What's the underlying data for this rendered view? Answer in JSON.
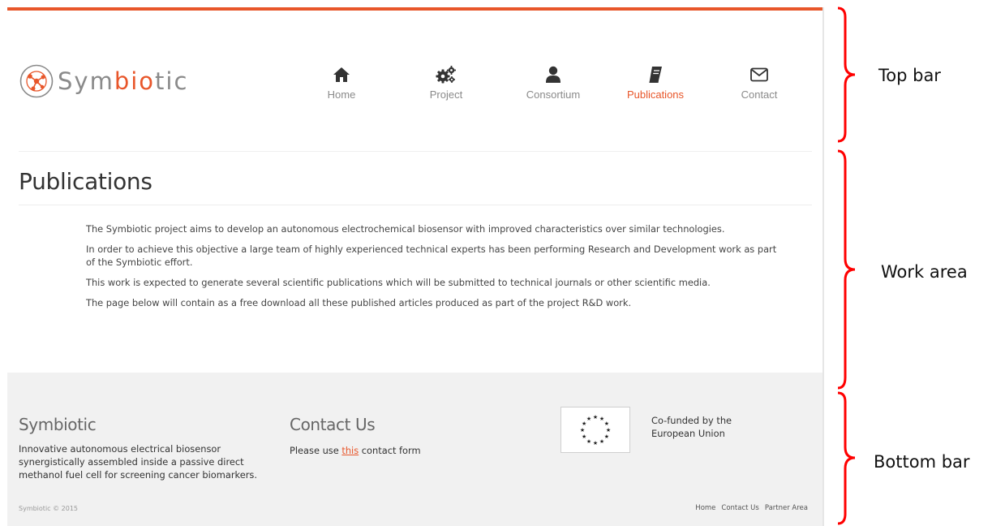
{
  "header": {
    "logo_prefix": "Sym",
    "logo_bio": "bio",
    "logo_suffix": "tic",
    "nav": [
      {
        "label": "Home",
        "icon": "home-icon",
        "active": false
      },
      {
        "label": "Project",
        "icon": "cogs-icon",
        "active": false
      },
      {
        "label": "Consortium",
        "icon": "user-icon",
        "active": false
      },
      {
        "label": "Publications",
        "icon": "book-icon",
        "active": true
      },
      {
        "label": "Contact",
        "icon": "envelope-icon",
        "active": false
      }
    ]
  },
  "main": {
    "title": "Publications",
    "paragraphs": [
      "The Symbiotic project aims to develop an autonomous electrochemical biosensor with improved characteristics over similar technologies.",
      "In order to achieve this objective a large team of highly experienced technical experts has been performing Research and Development work as part of the Symbiotic effort.",
      "This work is expected to generate several scientific publications which will be submitted to technical journals or other scientific media.",
      "The page below will contain as a free download all these published articles produced as part of the project R&D work."
    ]
  },
  "footer": {
    "brand_title": "Symbiotic",
    "brand_text": "Innovative autonomous electrical biosensor synergistically assembled inside a passive direct methanol fuel cell for screening cancer biomarkers.",
    "contact_title": "Contact Us",
    "contact_prefix": "Please use ",
    "contact_link": "this",
    "contact_suffix": " contact form",
    "eu_text": "Co-funded by the European Union",
    "copyright": "Symbiotic © 2015",
    "links": [
      "Home",
      "Contact Us",
      "Partner Area"
    ]
  },
  "annotations": {
    "top": "Top bar",
    "work": "Work area",
    "bottom": "Bottom bar"
  },
  "colors": {
    "accent": "#e8562a",
    "brace": "#ff0000",
    "footer_bg": "#f1f1f1",
    "nav_icon": "#333333"
  }
}
